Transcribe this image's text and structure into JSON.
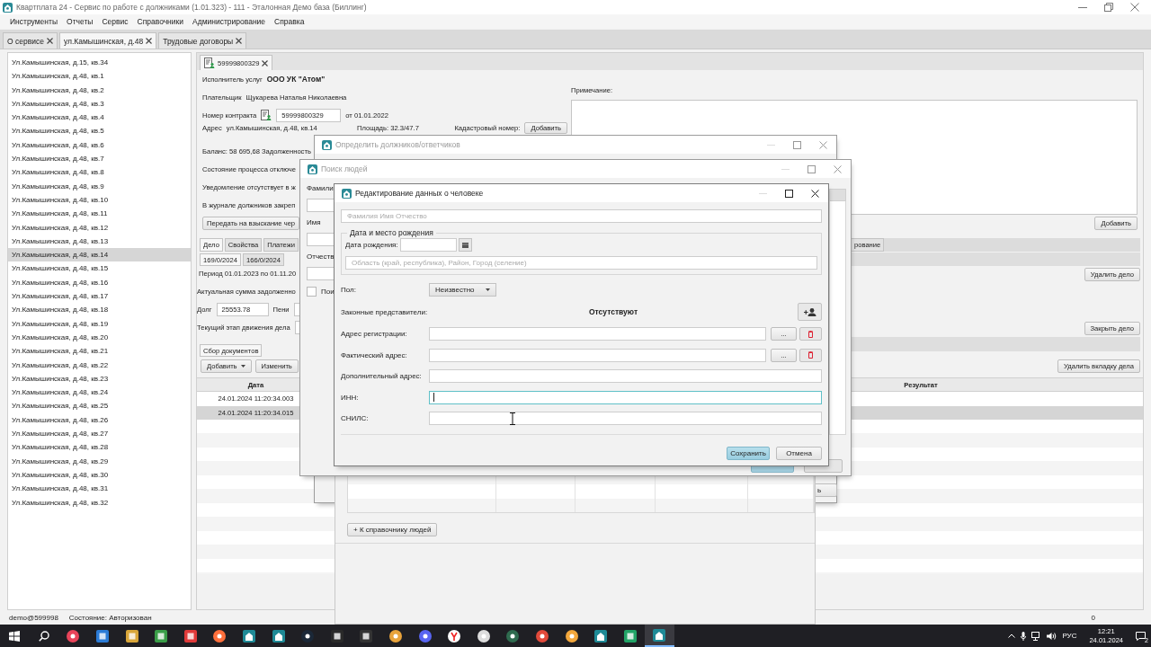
{
  "window": {
    "title": "Квартплата 24 - Сервис по работе с должниками (1.01.323) - 111 - Эталонная Демо база (Биллинг)"
  },
  "menu": [
    "Инструменты",
    "Отчеты",
    "Сервис",
    "Справочники",
    "Администрирование",
    "Справка"
  ],
  "tabs": [
    {
      "label": "О сервисе",
      "selected": false
    },
    {
      "label": "ул.Камышинская, д.48",
      "selected": true
    },
    {
      "label": "Трудовые договоры",
      "selected": false
    }
  ],
  "addresses": [
    {
      "label": "Ул.Камышинская, д.15, кв.34",
      "selected": false
    },
    {
      "label": "Ул.Камышинская, д.48, кв.1",
      "selected": false
    },
    {
      "label": "Ул.Камышинская, д.48, кв.2",
      "selected": false
    },
    {
      "label": "Ул.Камышинская, д.48, кв.3",
      "selected": false
    },
    {
      "label": "Ул.Камышинская, д.48, кв.4",
      "selected": false
    },
    {
      "label": "Ул.Камышинская, д.48, кв.5",
      "selected": false
    },
    {
      "label": "Ул.Камышинская, д.48, кв.6",
      "selected": false
    },
    {
      "label": "Ул.Камышинская, д.48, кв.7",
      "selected": false
    },
    {
      "label": "Ул.Камышинская, д.48, кв.8",
      "selected": false
    },
    {
      "label": "Ул.Камышинская, д.48, кв.9",
      "selected": false
    },
    {
      "label": "Ул.Камышинская, д.48, кв.10",
      "selected": false
    },
    {
      "label": "Ул.Камышинская, д.48, кв.11",
      "selected": false
    },
    {
      "label": "Ул.Камышинская, д.48, кв.12",
      "selected": false
    },
    {
      "label": "Ул.Камышинская, д.48, кв.13",
      "selected": false
    },
    {
      "label": "Ул.Камышинская, д.48, кв.14",
      "selected": true
    },
    {
      "label": "Ул.Камышинская, д.48, кв.15",
      "selected": false
    },
    {
      "label": "Ул.Камышинская, д.48, кв.16",
      "selected": false
    },
    {
      "label": "Ул.Камышинская, д.48, кв.17",
      "selected": false
    },
    {
      "label": "Ул.Камышинская, д.48, кв.18",
      "selected": false
    },
    {
      "label": "Ул.Камышинская, д.48, кв.19",
      "selected": false
    },
    {
      "label": "Ул.Камышинская, д.48, кв.20",
      "selected": false
    },
    {
      "label": "Ул.Камышинская, д.48, кв.21",
      "selected": false
    },
    {
      "label": "Ул.Камышинская, д.48, кв.22",
      "selected": false
    },
    {
      "label": "Ул.Камышинская, д.48, кв.23",
      "selected": false
    },
    {
      "label": "Ул.Камышинская, д.48, кв.24",
      "selected": false
    },
    {
      "label": "Ул.Камышинская, д.48, кв.25",
      "selected": false
    },
    {
      "label": "Ул.Камышинская, д.48, кв.26",
      "selected": false
    },
    {
      "label": "Ул.Камышинская, д.48, кв.27",
      "selected": false
    },
    {
      "label": "Ул.Камышинская, д.48, кв.28",
      "selected": false
    },
    {
      "label": "Ул.Камышинская, д.48, кв.29",
      "selected": false
    },
    {
      "label": "Ул.Камышинская, д.48, кв.30",
      "selected": false
    },
    {
      "label": "Ул.Камышинская, д.48, кв.31",
      "selected": false
    },
    {
      "label": "Ул.Камышинская, д.48, кв.32",
      "selected": false
    }
  ],
  "account": {
    "tab_label": "59999800329",
    "provider_label": "Исполнитель услуг",
    "provider": "ООО УК \"Атом\"",
    "payer_label": "Плательщик",
    "payer": "Щукарева Наталья Николаевна",
    "contract_label": "Номер контракта",
    "contract_number": "59999800329",
    "contract_date": "от 01.01.2022",
    "address_label": "Адрес",
    "address": "ул.Камышинская, д.48, кв.14",
    "area": "Площадь: 32.3/47.7",
    "cadastral_label": "Кадастровый номер:",
    "cadastral_button": "Добавить",
    "notes": [
      "Баланс: 58 695,68 Задолженность",
      "Состояние процесса отключе",
      "Уведомление отсутствует в ж",
      "В журнале должников закреп"
    ],
    "transfer_button": "Передать на взыскание чер",
    "note_label": "Примечание:",
    "note_add_button": "Добавить"
  },
  "case": {
    "tabs": [
      {
        "label": "Дело",
        "selected": true
      },
      {
        "label": "Свойства",
        "selected": false
      },
      {
        "label": "Платежи",
        "selected": false
      }
    ],
    "case_tabs": [
      {
        "label": "169/0/2024",
        "selected": true
      },
      {
        "label": "166/0/2024",
        "selected": false
      }
    ],
    "period": "Период 01.01.2023 по 01.11.20",
    "actual_sum_label": "Актуальная сумма задолженно",
    "debt_label": "Долг",
    "debt": "25553.78",
    "penalty_label": "Пени",
    "stage_label": "Текущий этап движения дела",
    "tab_fragment": "рование",
    "delete_case_button": "Удалить дело",
    "close_case_button": "Закрыть дело",
    "delete_tab_button": "Удалить вкладку дела"
  },
  "documents": {
    "tab": "Сбор документов",
    "add_button": "Добавить",
    "edit_button": "Изменить",
    "columns": [
      "Дата",
      "Результат"
    ],
    "rows": [
      {
        "date": "24.01.2024 11:20:34.003",
        "selected": false
      },
      {
        "date": "24.01.2024 11:20:34.015",
        "selected": true
      }
    ]
  },
  "status_bar": {
    "user": "demo@599998",
    "state": "Состояние: Авторизован",
    "counter": "0"
  },
  "taskbar": {
    "language": "РУС",
    "time": "12:21",
    "date": "24.01.2024",
    "notifications": "2"
  },
  "debtors_dialog": {
    "title": "Определить должников/ответчиков",
    "active": false,
    "button_fragment": "ь"
  },
  "people_panel": {
    "button": "+ К справочнику людей"
  },
  "search_dialog": {
    "title": "Поиск людей",
    "active": false,
    "labels": [
      "Фамили",
      "Имя",
      "Отчеств"
    ],
    "checkbox": {
      "label": "Пои",
      "checked": false
    }
  },
  "person_dialog": {
    "title": "Редактирование данных о человеке",
    "active": true,
    "name_placeholder": "Фамилия Имя Отчество",
    "birth_group": "Дата и место рождения",
    "birth_date_label": "Дата рождения:",
    "birth_place_placeholder": "Область (край, республика), Район, Город (селение)",
    "gender_label": "Пол:",
    "gender": "Неизвестно",
    "representatives_label": "Законные представители:",
    "representatives": "Отсутствуют",
    "fields": [
      {
        "label": "Адрес регистрации:",
        "kind": "address",
        "pick_button": "...",
        "focused": false
      },
      {
        "label": "Фактический адрес:",
        "kind": "address",
        "pick_button": "...",
        "focused": false
      },
      {
        "label": "Дополнительный адрес:",
        "kind": "text",
        "focused": false
      },
      {
        "label": "ИНН:",
        "kind": "text",
        "focused": true
      },
      {
        "label": "СНИЛС:",
        "kind": "text",
        "focused": false
      }
    ],
    "save_button": "Сохранить",
    "cancel_button": "Отмена"
  }
}
